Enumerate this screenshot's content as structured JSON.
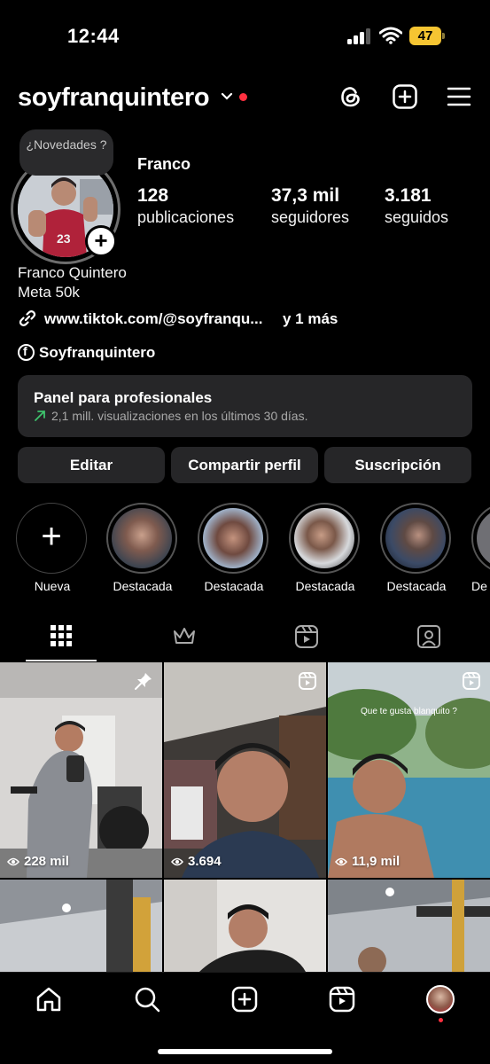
{
  "status_bar": {
    "time": "12:44",
    "battery": "47"
  },
  "header": {
    "username": "soyfranquintero"
  },
  "profile": {
    "novedades": "¿Novedades ?",
    "display_name": "Franco",
    "stats": [
      {
        "value": "128",
        "label": "publicaciones"
      },
      {
        "value": "37,3 mil",
        "label": "seguidores"
      },
      {
        "value": "3.181",
        "label": "seguidos"
      }
    ],
    "bio_lines": [
      "Franco Quintero",
      "Meta 50k"
    ],
    "link": "www.tiktok.com/@soyfranqu...",
    "link_more": "y 1 más",
    "facebook": "Soyfranquintero"
  },
  "dashboard": {
    "title": "Panel para profesionales",
    "subtitle": "2,1 mill. visualizaciones en los últimos 30 días."
  },
  "buttons": {
    "edit": "Editar",
    "share": "Compartir perfil",
    "subscribe": "Suscripción"
  },
  "highlights": [
    {
      "label": "Nueva"
    },
    {
      "label": "Destacada"
    },
    {
      "label": "Destacada"
    },
    {
      "label": "Destacada"
    },
    {
      "label": "Destacada"
    },
    {
      "label": "De"
    }
  ],
  "tabs": [
    "grid-icon",
    "crown-icon",
    "reels-icon",
    "tagged-icon"
  ],
  "grid": [
    {
      "views": "228 mil",
      "badge": "pin-icon"
    },
    {
      "views": "3.694",
      "badge": "reel-icon"
    },
    {
      "views": "11,9 mil",
      "badge": "reel-icon",
      "caption": "Que te gusta blanquito ?"
    },
    {
      "views": ""
    },
    {
      "views": ""
    },
    {
      "views": ""
    }
  ],
  "bottom_nav": [
    "home-icon",
    "search-icon",
    "create-icon",
    "reels-icon",
    "profile-avatar"
  ],
  "colors": {
    "accent_red": "#ff3040",
    "panel": "#262628",
    "battery": "#f6c532",
    "trend_green": "#3ec46d"
  }
}
